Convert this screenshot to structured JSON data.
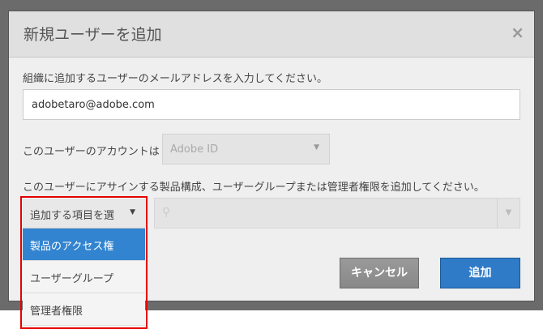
{
  "dialog": {
    "title": "新規ユーザーを追加",
    "close_icon": "×"
  },
  "email": {
    "label": "組織に追加するユーザーのメールアドレスを入力してください。",
    "value": "adobetaro@adobe.com"
  },
  "account": {
    "label": "このユーザーのアカウントは",
    "value": "Adobe ID"
  },
  "assign": {
    "label": "このユーザーにアサインする製品構成、ユーザーグループまたは管理者権限を追加してください。"
  },
  "type_select": {
    "value": "追加する項目を選",
    "options": [
      "製品のアクセス権",
      "ユーザーグループ",
      "管理者権限"
    ]
  },
  "buttons": {
    "cancel": "キャンセル",
    "add": "追加"
  },
  "colors": {
    "accent": "#3284d0",
    "highlight": "#e60000"
  }
}
